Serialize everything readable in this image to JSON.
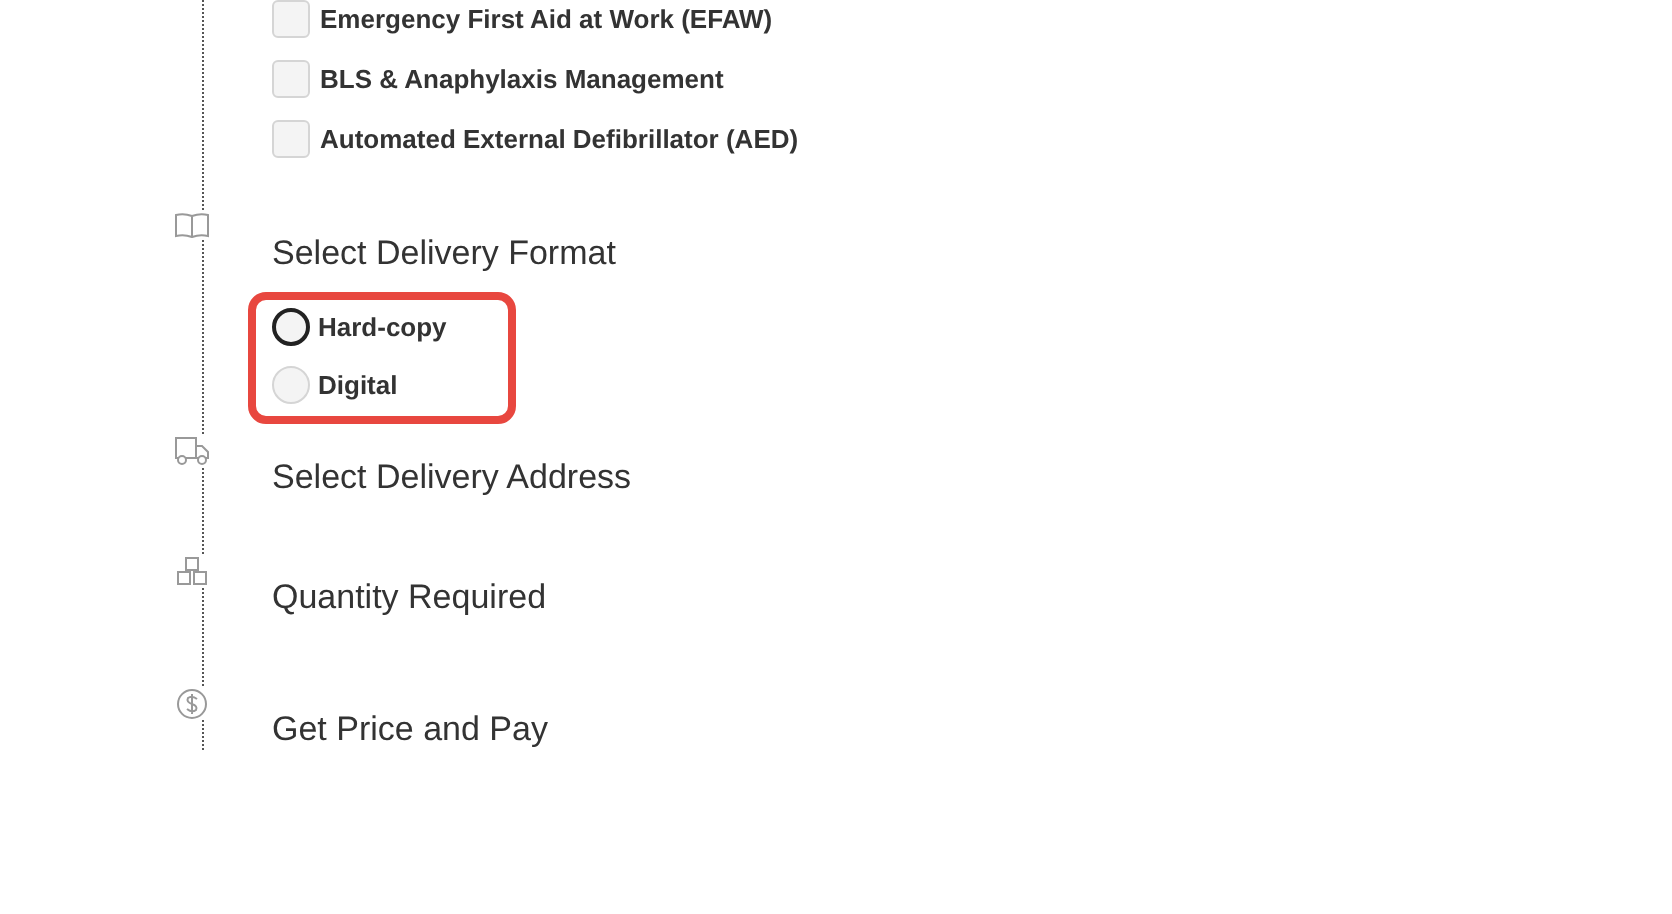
{
  "courses": [
    {
      "label": "Emergency First Aid at Work (EFAW)",
      "checked": false
    },
    {
      "label": "BLS & Anaphylaxis Management",
      "checked": false
    },
    {
      "label": "Automated External Defibrillator (AED)",
      "checked": false
    }
  ],
  "steps": [
    {
      "kind": "format",
      "title": "Select Delivery Format",
      "highlighted": true,
      "options": [
        {
          "label": "Hard-copy",
          "selected": false,
          "focused": true
        },
        {
          "label": "Digital",
          "selected": false,
          "focused": false
        }
      ]
    },
    {
      "kind": "address",
      "title": "Select Delivery Address"
    },
    {
      "kind": "quantity",
      "title": "Quantity Required"
    },
    {
      "kind": "price",
      "title": "Get Price and Pay"
    }
  ]
}
